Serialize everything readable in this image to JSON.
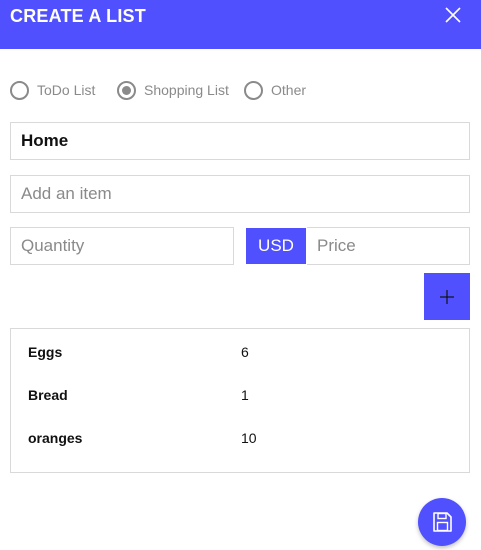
{
  "header": {
    "title": "CREATE A LIST"
  },
  "list_types": [
    {
      "label": "ToDo List",
      "checked": false
    },
    {
      "label": "Shopping List",
      "checked": true
    },
    {
      "label": "Other",
      "checked": false
    }
  ],
  "form": {
    "name_value": "Home",
    "item_placeholder": "Add an item",
    "quantity_placeholder": "Quantity",
    "currency": "USD",
    "price_placeholder": "Price"
  },
  "items": [
    {
      "name": "Eggs",
      "quantity": "6"
    },
    {
      "name": "Bread",
      "quantity": "1"
    },
    {
      "name": "oranges",
      "quantity": "10"
    }
  ],
  "icons": {
    "close": "close-icon",
    "add": "plus-icon",
    "save": "save-icon"
  },
  "colors": {
    "accent": "#5050ff",
    "muted": "#8a8a8a",
    "border": "#d9d9d9"
  }
}
